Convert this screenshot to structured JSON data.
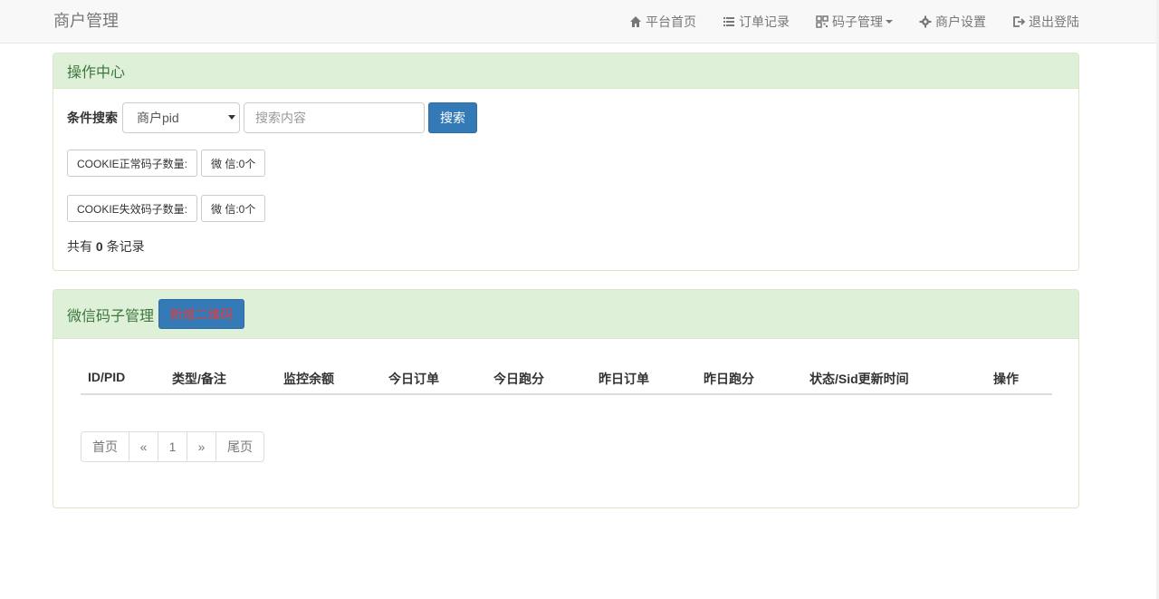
{
  "navbar": {
    "brand": "商户管理",
    "items": [
      {
        "label": "平台首页",
        "icon": "home-icon"
      },
      {
        "label": "订单记录",
        "icon": "list-icon"
      },
      {
        "label": "码子管理",
        "icon": "qrcode-icon"
      },
      {
        "label": "商户设置",
        "icon": "gear-icon"
      },
      {
        "label": "退出登陆",
        "icon": "logout-icon"
      }
    ]
  },
  "ops_panel": {
    "title": "操作中心",
    "search": {
      "label": "条件搜索",
      "select_value": "商户pid",
      "input_placeholder": "搜索内容",
      "button_label": "搜索"
    },
    "cookie_ok": {
      "label": "COOKIE正常码子数量:",
      "value": "微 信:0个"
    },
    "cookie_fail": {
      "label": "COOKIE失效码子数量:",
      "value": "微 信:0个"
    },
    "total": {
      "prefix": "共有",
      "count": "0",
      "suffix": "条记录"
    }
  },
  "wx_panel": {
    "title": "微信码子管理",
    "add_button": "新增二维码",
    "columns": [
      "ID/PID",
      "类型/备注",
      "监控余额",
      "今日订单",
      "今日跑分",
      "昨日订单",
      "昨日跑分",
      "状态/Sid更新时间",
      "操作"
    ],
    "pagination": {
      "first": "首页",
      "prev": "«",
      "current": "1",
      "next": "»",
      "last": "尾页"
    }
  },
  "colors": {
    "panel_heading_bg": "#dff0d8",
    "panel_heading_text": "#3c763d",
    "primary": "#337ab7",
    "add_button_text": "#e83a3a"
  }
}
